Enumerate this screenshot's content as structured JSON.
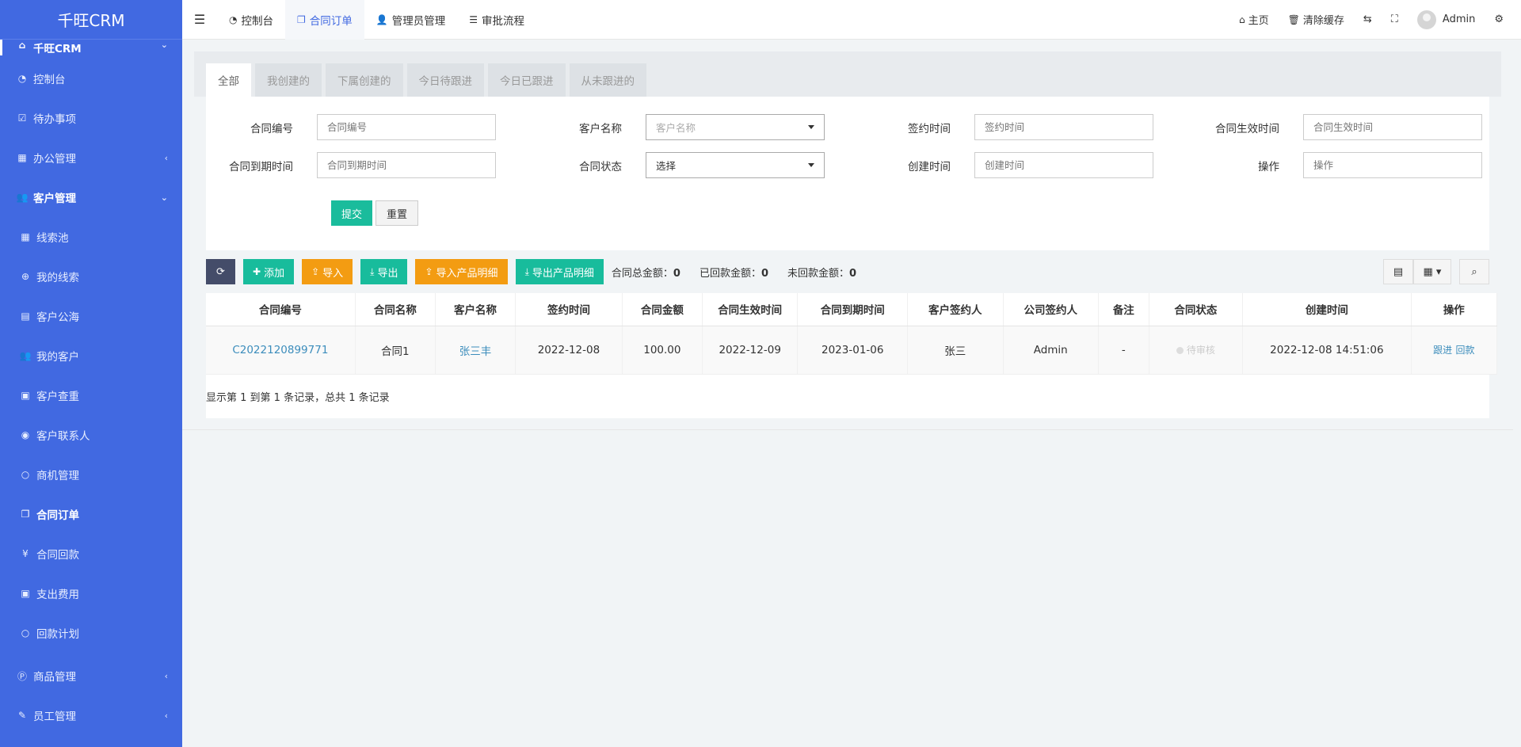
{
  "app": {
    "logo": "千旺CRM"
  },
  "sidebar": {
    "items": [
      {
        "label": "千旺CRM",
        "icon": "home-icon",
        "glyph": "⌂",
        "arrow": "⌄"
      },
      {
        "label": "控制台",
        "icon": "dashboard-icon",
        "glyph": "◔"
      },
      {
        "label": "待办事项",
        "icon": "calendar-check-icon",
        "glyph": "☑"
      },
      {
        "label": "办公管理",
        "icon": "windows-icon",
        "glyph": "▦",
        "arrow": "‹"
      },
      {
        "label": "客户管理",
        "icon": "users-icon",
        "glyph": "👥",
        "arrow": "⌄"
      },
      {
        "label": "线索池",
        "icon": "grid-icon",
        "glyph": "▦"
      },
      {
        "label": "我的线索",
        "icon": "search-plus-icon",
        "glyph": "⊕"
      },
      {
        "label": "客户公海",
        "icon": "map-icon",
        "glyph": "▤"
      },
      {
        "label": "我的客户",
        "icon": "users-icon",
        "glyph": "👥"
      },
      {
        "label": "客户查重",
        "icon": "id-card-icon",
        "glyph": "▣"
      },
      {
        "label": "客户联系人",
        "icon": "user-circle-icon",
        "glyph": "◉"
      },
      {
        "label": "商机管理",
        "icon": "circle-icon",
        "glyph": "○"
      },
      {
        "label": "合同订单",
        "icon": "copy-icon",
        "glyph": "❐"
      },
      {
        "label": "合同回款",
        "icon": "yen-icon",
        "glyph": "¥"
      },
      {
        "label": "支出费用",
        "icon": "money-icon",
        "glyph": "▣"
      },
      {
        "label": "回款计划",
        "icon": "circle-icon",
        "glyph": "○"
      },
      {
        "label": "商品管理",
        "icon": "product-hunt-icon",
        "glyph": "Ⓟ",
        "arrow": "‹"
      },
      {
        "label": "员工管理",
        "icon": "brush-icon",
        "glyph": "✎",
        "arrow": "‹"
      }
    ]
  },
  "topbar": {
    "tabs": [
      {
        "label": "控制台",
        "icon": "dashboard-icon",
        "glyph": "◔"
      },
      {
        "label": "合同订单",
        "icon": "copy-icon",
        "glyph": "❐"
      },
      {
        "label": "管理员管理",
        "icon": "user-icon",
        "glyph": "👤"
      },
      {
        "label": "审批流程",
        "icon": "list-icon",
        "glyph": "☰"
      }
    ],
    "right": {
      "home": "主页",
      "clear_cache": "清除缓存",
      "user": "Admin"
    }
  },
  "filter_tabs": [
    "全部",
    "我创建的",
    "下属创建的",
    "今日待跟进",
    "今日已跟进",
    "从未跟进的"
  ],
  "form": {
    "fields": [
      {
        "label": "合同编号",
        "placeholder": "合同编号"
      },
      {
        "label": "客户名称",
        "placeholder": "客户名称"
      },
      {
        "label": "签约时间",
        "placeholder": "签约时间"
      },
      {
        "label": "合同生效时间",
        "placeholder": "合同生效时间"
      },
      {
        "label": "合同到期时间",
        "placeholder": "合同到期时间"
      },
      {
        "label": "合同状态",
        "value": "选择"
      },
      {
        "label": "创建时间",
        "placeholder": "创建时间"
      },
      {
        "label": "操作",
        "placeholder": "操作"
      }
    ],
    "submit": "提交",
    "reset": "重置"
  },
  "toolbar": {
    "add": "添加",
    "import": "导入",
    "export": "导出",
    "import_products": "导入产品明细",
    "export_products": "导出产品明细",
    "summary": [
      {
        "label": "合同总金额：",
        "value": "0"
      },
      {
        "label": "已回款金额：",
        "value": "0"
      },
      {
        "label": "未回款金额：",
        "value": "0"
      }
    ]
  },
  "table": {
    "columns": [
      "合同编号",
      "合同名称",
      "客户名称",
      "签约时间",
      "合同金额",
      "合同生效时间",
      "合同到期时间",
      "客户签约人",
      "公司签约人",
      "备注",
      "合同状态",
      "创建时间",
      "操作"
    ],
    "rows": [
      {
        "no": "C2022120899771",
        "name": "合同1",
        "customer": "张三丰",
        "sign_date": "2022-12-08",
        "amount": "100.00",
        "effective": "2022-12-09",
        "expiry": "2023-01-06",
        "customer_signer": "张三",
        "company_signer": "Admin",
        "remark": "-",
        "status": "待审核",
        "created": "2022-12-08 14:51:06",
        "op_follow": "跟进",
        "op_payment": "回款"
      }
    ]
  },
  "pager": "显示第 1 到第 1 条记录，总共 1 条记录",
  "colors": {
    "sidebar": "#4169e1",
    "accent_green": "#18bc9c",
    "accent_orange": "#f39c12",
    "link": "#3c8dbc",
    "dark_button": "#444c69"
  }
}
